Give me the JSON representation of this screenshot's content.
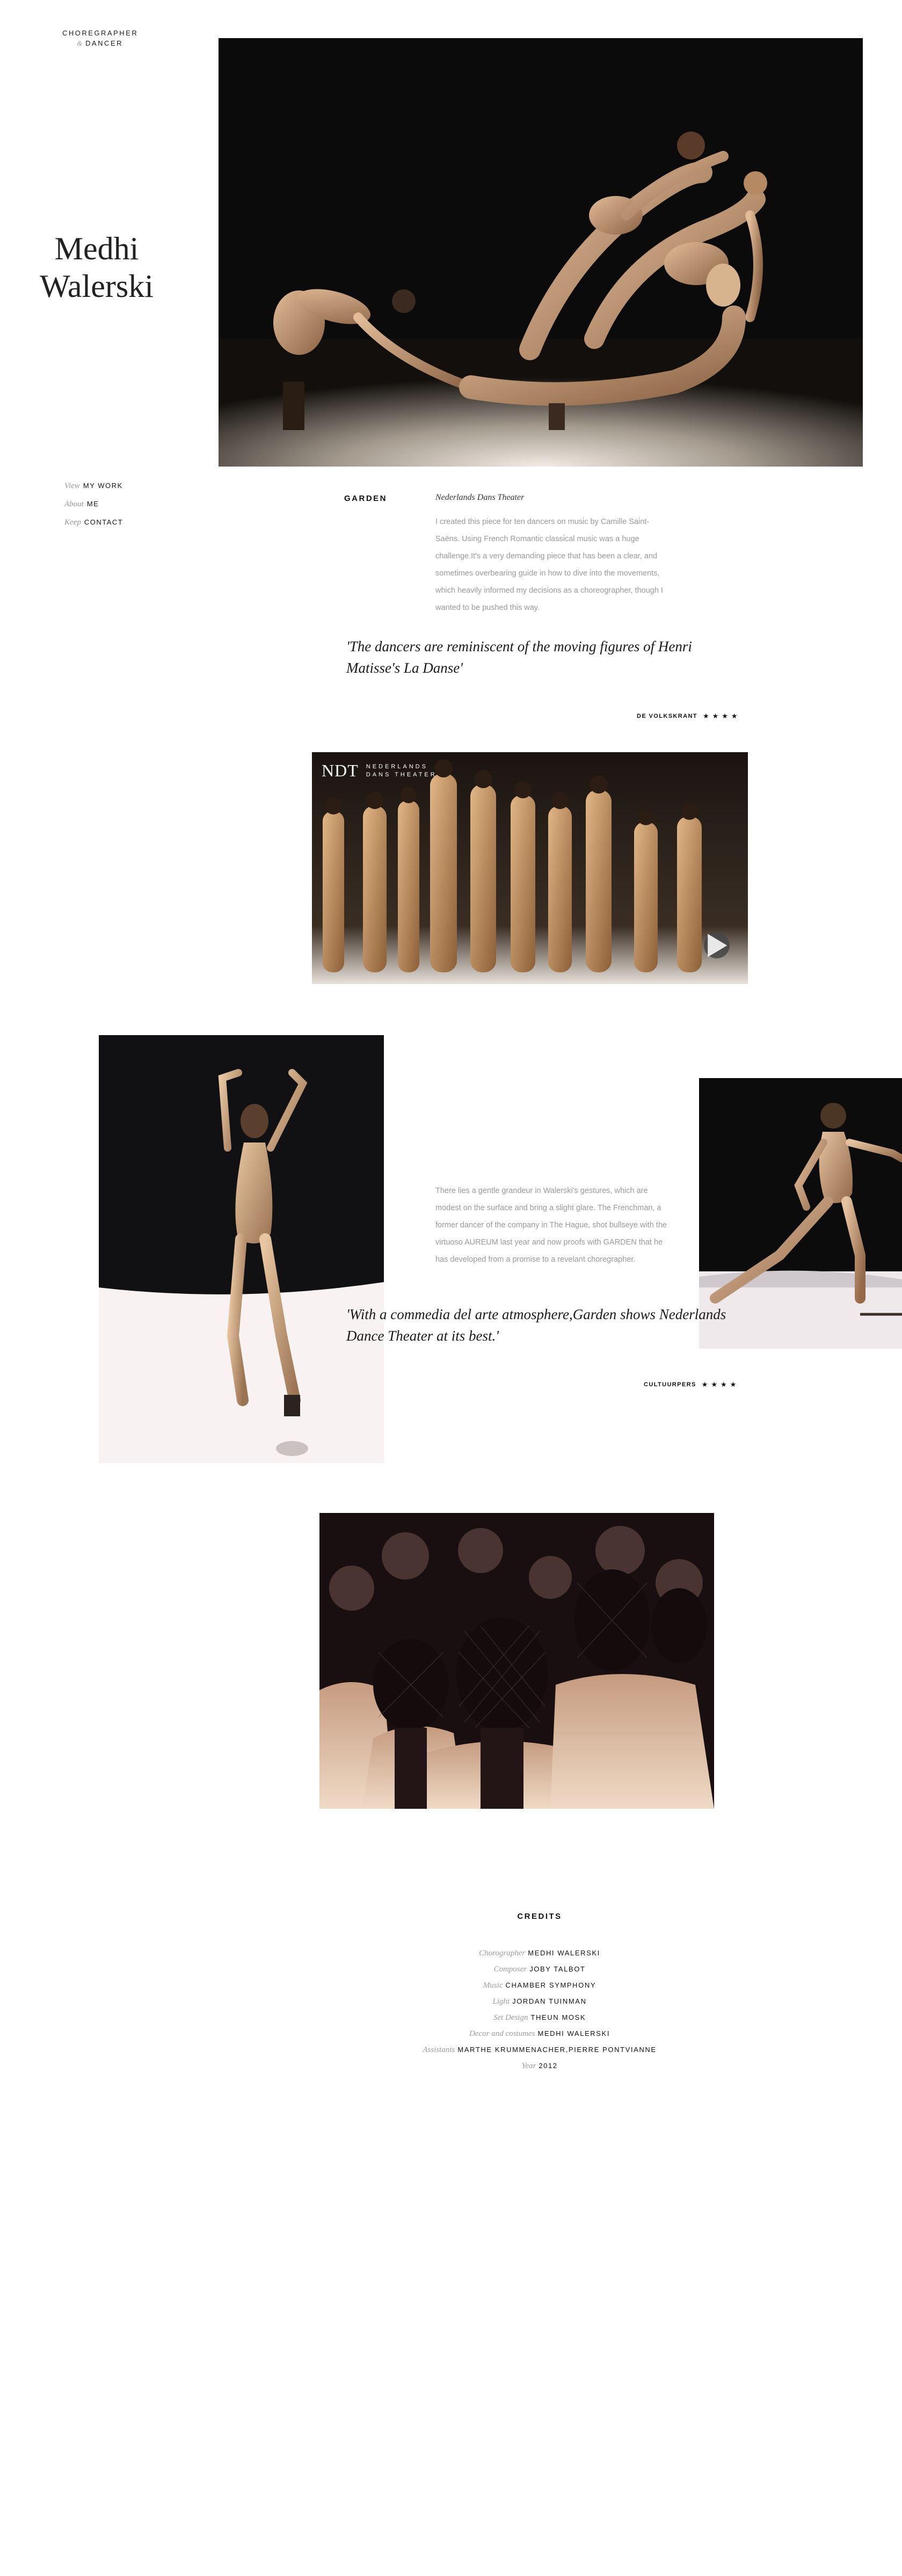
{
  "brand": {
    "line1": "Choregrapher",
    "amp": "&",
    "line2": "Dancer"
  },
  "name": {
    "first": "Medhi",
    "last": "Walerski"
  },
  "nav": [
    {
      "prefix": "View",
      "label": "My Work"
    },
    {
      "prefix": "About",
      "label": "Me"
    },
    {
      "prefix": "Keep",
      "label": "Contact"
    }
  ],
  "article": {
    "title": "Garden",
    "subtitle": "Nederlands Dans Theater",
    "intro": "I created this piece for ten dancers on music by Camille Saint-Saëns. Using French Romantic classical music was a huge challenge.It's a very demanding piece that has been a clear, and sometimes overbearing guide in how to dive into the movements, which heavily informed my decisions as a choreographer, though I wanted to be pushed this way.",
    "quote1": "'The dancers are reminiscent of the moving figures of Henri Matisse's La Danse'",
    "review1_source": "De Volkskrant",
    "review1_stars": "★★★★",
    "video_logo": "NDT",
    "video_logo_line1": "Nederlands",
    "video_logo_line2": "Dans Theater",
    "body2": "There lies a gentle grandeur in Walerski's gestures, which are modest on the surface and bring a slight glare. The Frenchman, a former dancer of the company in The Hague, shot bullseye with the virtuoso AUREUM last year and now proofs with GARDEN that he has developed from a promise to a revelant choregrapher.",
    "quote2": "'With a commedia del arte atmosphere,Garden shows Nederlands Dance Theater at its best.'",
    "review2_source": "Cultuurpers",
    "review2_stars": "★★★★"
  },
  "credits": {
    "title": "Credits",
    "items": [
      {
        "role": "Chorographer",
        "value": "Medhi Walerski"
      },
      {
        "role": "Composer",
        "value": "Joby Talbot"
      },
      {
        "role": "Music",
        "value": "Chamber Symphony"
      },
      {
        "role": "Light",
        "value": "Jordan Tuinman"
      },
      {
        "role": "Set Design",
        "value": "Theun Mosk"
      },
      {
        "role": "Decor and costumes",
        "value": "Medhi Walerski"
      },
      {
        "role": "Assistants",
        "value": "Marthe Krummenacher,Pierre Pontvianne"
      },
      {
        "role": "Year",
        "value": "2012"
      }
    ]
  },
  "icons": {
    "play": "play-icon",
    "stars": "star-icon"
  },
  "colors": {
    "text": "#1a1a1a",
    "muted": "#9a9a9a",
    "stage_dark": "#0f0d0b",
    "skin": "#c9a07a"
  }
}
